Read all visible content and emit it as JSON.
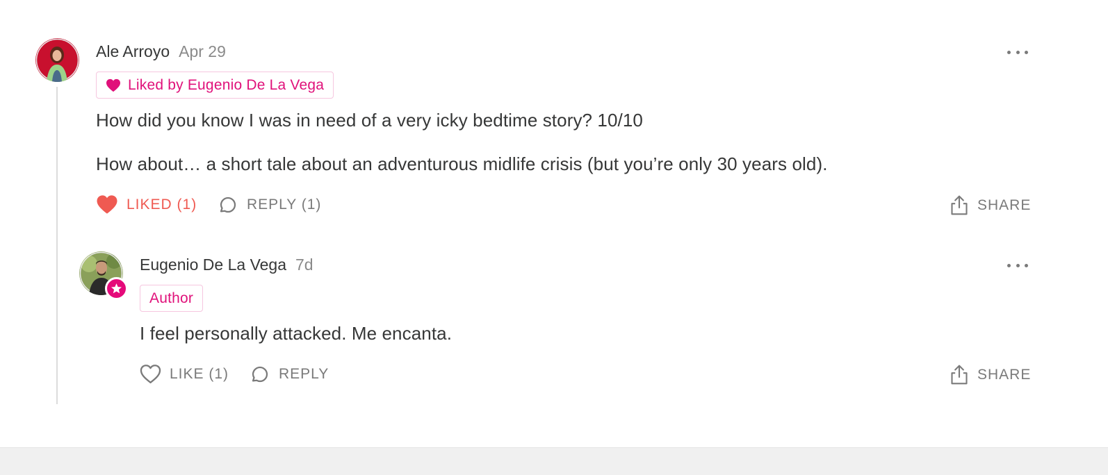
{
  "colors": {
    "accent_pink": "#e0117a",
    "liked_red": "#ef5a52",
    "muted_text": "#7a7a7a"
  },
  "comments": [
    {
      "author": "Ale Arroyo",
      "date": "Apr 29",
      "badge_label": "Liked by Eugenio De La Vega",
      "badge_icon": "heart-icon",
      "paragraphs": [
        "How did you know I was in need of a very icky bedtime story? 10/10",
        "How about… a short tale about an adventurous midlife crisis (but you’re only 30 years old)."
      ],
      "actions": {
        "like_label": "LIKED (1)",
        "liked": true,
        "reply_label": "REPLY (1)",
        "share_label": "SHARE"
      }
    },
    {
      "author": "Eugenio De La Vega",
      "date": "7d",
      "badge_label": "Author",
      "avatar_badge_icon": "star-icon",
      "paragraphs": [
        "I feel personally attacked. Me encanta."
      ],
      "actions": {
        "like_label": "LIKE (1)",
        "liked": false,
        "reply_label": "REPLY",
        "share_label": "SHARE"
      }
    }
  ]
}
